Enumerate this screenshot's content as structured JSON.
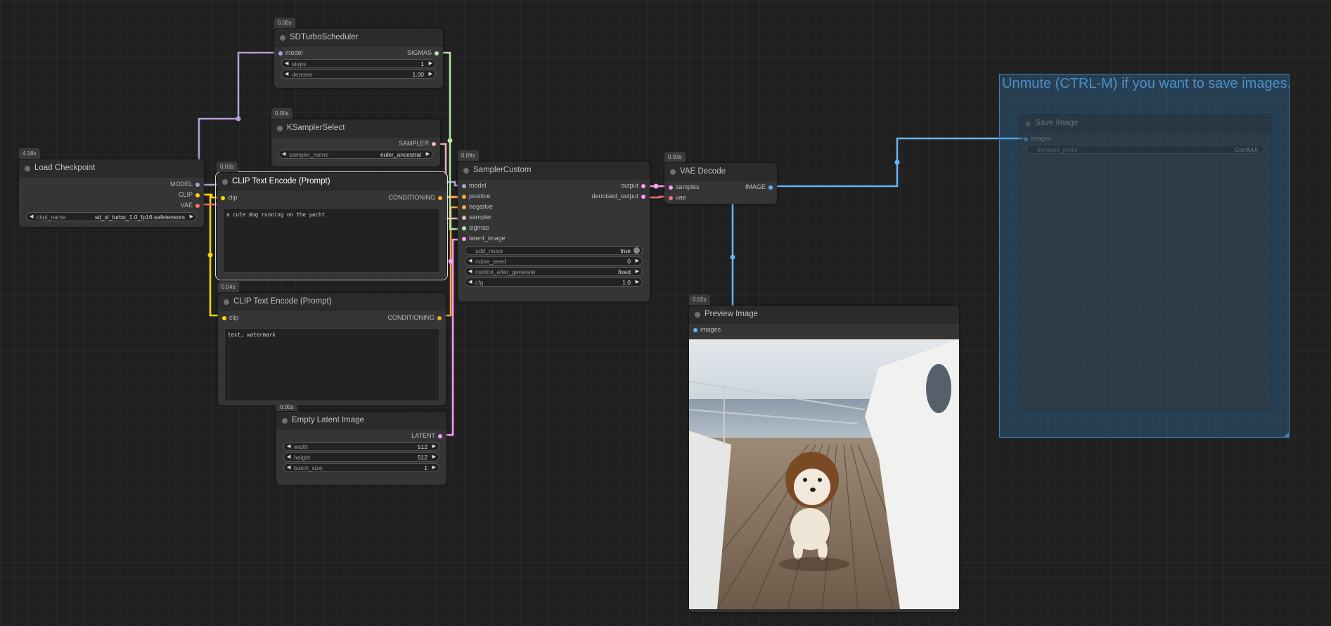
{
  "group": {
    "title": "Unmute (CTRL-M) if you want to save images."
  },
  "nodes": {
    "sdturbo": {
      "title": "SDTurboScheduler",
      "time": "0.00s",
      "in_model": "model",
      "out_sigmas": "SIGMAS",
      "widgets": [
        {
          "name": "steps",
          "value": "1"
        },
        {
          "name": "denoise",
          "value": "1.00"
        }
      ]
    },
    "ksamplerselect": {
      "title": "KSamplerSelect",
      "time": "0.00s",
      "out_sampler": "SAMPLER",
      "widget": {
        "name": "sampler_name",
        "value": "euler_ancestral"
      }
    },
    "loadcheckpoint": {
      "title": "Load Checkpoint",
      "time": "4.18s",
      "out_model": "MODEL",
      "out_clip": "CLIP",
      "out_vae": "VAE",
      "widget": {
        "name": "ckpt_name",
        "value": "sd_xl_turbo_1.0_fp16.safetensors"
      }
    },
    "clip1": {
      "title": "CLIP Text Encode (Prompt)",
      "time": "0.03s",
      "in_clip": "clip",
      "out_cond": "CONDITIONING",
      "text": "a cute dog running on the yacht"
    },
    "clip2": {
      "title": "CLIP Text Encode (Prompt)",
      "time": "0.04s",
      "in_clip": "clip",
      "out_cond": "CONDITIONING",
      "text": "text, watermark"
    },
    "emptylatent": {
      "title": "Empty Latent Image",
      "time": "0.00s",
      "out_latent": "LATENT",
      "widgets": [
        {
          "name": "width",
          "value": "512"
        },
        {
          "name": "height",
          "value": "512"
        },
        {
          "name": "batch_size",
          "value": "1"
        }
      ]
    },
    "samplercustom": {
      "title": "SamplerCustom",
      "time": "0.09s",
      "inputs": [
        "model",
        "positive",
        "negative",
        "sampler",
        "sigmas",
        "latent_image"
      ],
      "out_output": "output",
      "out_denoised": "denoised_output",
      "widgets": [
        {
          "name": "add_noise",
          "value": "true"
        },
        {
          "name": "noise_seed",
          "value": "0"
        },
        {
          "name": "control_after_generate",
          "value": "fixed"
        },
        {
          "name": "cfg",
          "value": "1.0"
        }
      ]
    },
    "vaedecode": {
      "title": "VAE Decode",
      "time": "0.03s",
      "in_samples": "samples",
      "in_vae": "vae",
      "out_image": "IMAGE"
    },
    "preview": {
      "title": "Preview Image",
      "time": "0.02s",
      "in_images": "images"
    },
    "saveimage": {
      "title": "Save Image",
      "in_images": "images",
      "widget": {
        "name": "filename_prefix",
        "value": "ComfyUI"
      }
    }
  },
  "colors": {
    "model": "#b39ddb",
    "clip": "#ffd500",
    "vae": "#ff6e6e",
    "conditioning": "#ffa931",
    "latent": "#ff9cf9",
    "image": "#64b5f6",
    "sigmas": "#b4e6a6",
    "sampler": "#ecb4b4"
  }
}
